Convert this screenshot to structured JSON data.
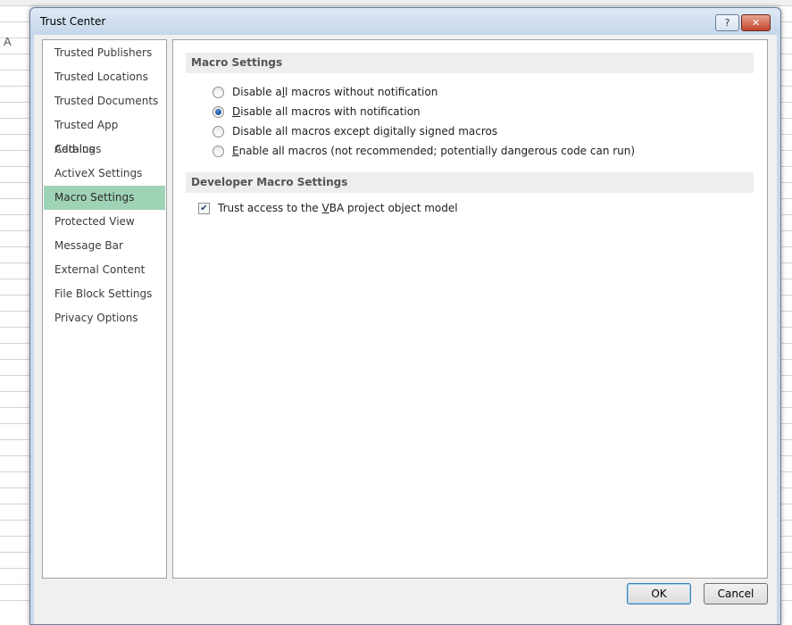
{
  "background_sheet": {
    "column_label": "A"
  },
  "dialog": {
    "title": "Trust Center",
    "help_label": "?",
    "close_label": "✕"
  },
  "nav": {
    "items": [
      {
        "label": "Trusted Publishers",
        "active": false
      },
      {
        "label": "Trusted Locations",
        "active": false
      },
      {
        "label": "Trusted Documents",
        "active": false
      },
      {
        "label": "Trusted App Catalogs",
        "active": false
      },
      {
        "label": "Add-ins",
        "active": false
      },
      {
        "label": "ActiveX Settings",
        "active": false
      },
      {
        "label": "Macro Settings",
        "active": true
      },
      {
        "label": "Protected View",
        "active": false
      },
      {
        "label": "Message Bar",
        "active": false
      },
      {
        "label": "External Content",
        "active": false
      },
      {
        "label": "File Block Settings",
        "active": false
      },
      {
        "label": "Privacy Options",
        "active": false
      }
    ],
    "active_color": "#9fd3b6"
  },
  "macro_settings": {
    "header": "Macro Settings",
    "options": [
      {
        "pre": "Disable a",
        "ul": "l",
        "post": "l macros without notification",
        "checked": false
      },
      {
        "pre": "",
        "ul": "D",
        "post": "isable all macros with notification",
        "checked": true
      },
      {
        "pre": "Disable all macros except di",
        "ul": "g",
        "post": "itally signed macros",
        "checked": false
      },
      {
        "pre": "",
        "ul": "E",
        "post": "nable all macros (not recommended; potentially dangerous code can run)",
        "checked": false
      }
    ]
  },
  "developer_settings": {
    "header": "Developer Macro Settings",
    "trust_vba": {
      "pre": "Trust access to the ",
      "ul": "V",
      "post": "BA project object model",
      "checked": true
    }
  },
  "footer": {
    "ok_label": "OK",
    "cancel_label": "Cancel"
  }
}
